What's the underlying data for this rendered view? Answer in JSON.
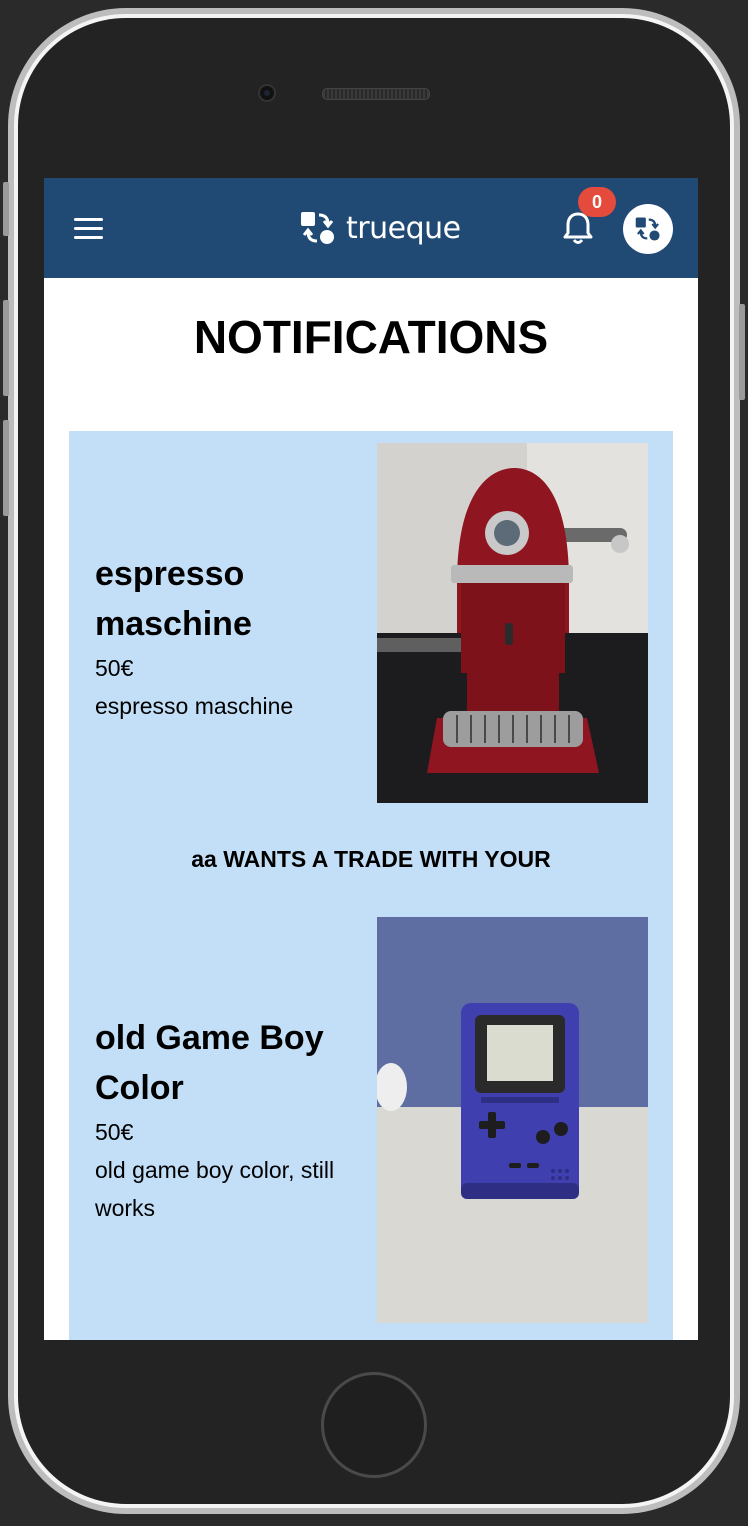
{
  "app": {
    "brand_name": "trueque",
    "notification_count": "0",
    "colors": {
      "navbar": "#204a74",
      "card": "#c3dff7",
      "badge": "#e54b3c"
    }
  },
  "page": {
    "title": "NOTIFICATIONS"
  },
  "notification": {
    "offered_item": {
      "title": "espresso maschine",
      "price": "50€",
      "description": "espresso maschine",
      "image_icon": "espresso-machine-photo"
    },
    "message": "aa WANTS A TRADE WITH YOUR",
    "requested_item": {
      "title": "old Game Boy Color",
      "price": "50€",
      "description": "old game boy color, still works",
      "image_icon": "game-boy-color-photo"
    }
  }
}
